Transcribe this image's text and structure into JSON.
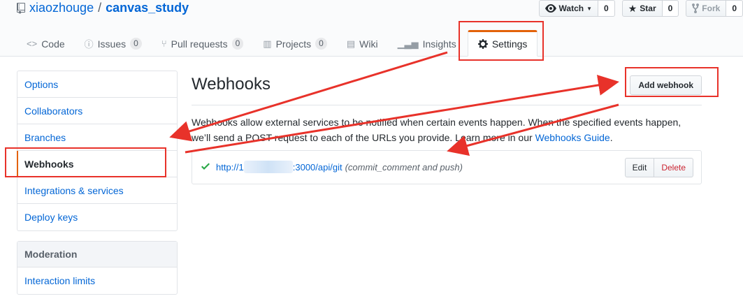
{
  "repo": {
    "owner": "xiaozhouge",
    "separator": "/",
    "name": "canvas_study"
  },
  "actions": [
    {
      "label": "Watch",
      "count": "0",
      "icon": "eye-icon",
      "dropdown": true
    },
    {
      "label": "Star",
      "count": "0",
      "icon": "star-icon"
    },
    {
      "label": "Fork",
      "count": "0",
      "icon": "fork-icon",
      "disabled": true
    }
  ],
  "tabs": [
    {
      "label": "Code",
      "icon": "code-icon"
    },
    {
      "label": "Issues",
      "count": "0",
      "icon": "issue-icon"
    },
    {
      "label": "Pull requests",
      "count": "0",
      "icon": "pull-request-icon"
    },
    {
      "label": "Projects",
      "count": "0",
      "icon": "project-icon"
    },
    {
      "label": "Wiki",
      "icon": "book-icon"
    },
    {
      "label": "Insights",
      "icon": "graph-icon"
    },
    {
      "label": "Settings",
      "icon": "gear-icon",
      "selected": true
    }
  ],
  "sidebar": {
    "items": [
      "Options",
      "Collaborators",
      "Branches",
      "Webhooks",
      "Integrations & services",
      "Deploy keys"
    ],
    "selected": "Webhooks",
    "moderation_heading": "Moderation",
    "moderation_items": [
      "Interaction limits"
    ]
  },
  "main": {
    "title": "Webhooks",
    "add_button": "Add webhook",
    "description": "Webhooks allow external services to be notified when certain events happen. When the specified events happen, we’ll send a POST request to each of the URLs you provide. Learn more in our ",
    "guide_link": "Webhooks Guide",
    "description_end": "."
  },
  "webhook": {
    "url_prefix": "http://1",
    "url_suffix": ":3000/api/git",
    "events": "(commit_comment and push)",
    "edit_label": "Edit",
    "delete_label": "Delete"
  },
  "colors": {
    "accent": "#e36209",
    "link": "#0366d6",
    "annotation": "#e8322a",
    "success": "#28a745",
    "danger": "#cb2431"
  }
}
